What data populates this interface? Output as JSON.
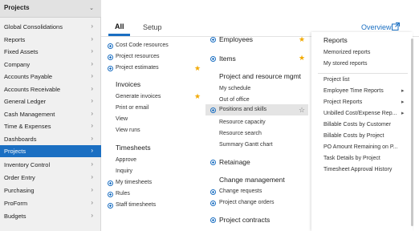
{
  "sidebar": {
    "header": "Projects",
    "items": [
      {
        "label": "Global Consolidations",
        "active": false
      },
      {
        "label": "Reports",
        "active": false
      },
      {
        "label": "Fixed Assets",
        "active": false
      },
      {
        "label": "Company",
        "active": false
      },
      {
        "label": "Accounts Payable",
        "active": false
      },
      {
        "label": "Accounts Receivable",
        "active": false
      },
      {
        "label": "General Ledger",
        "active": false
      },
      {
        "label": "Cash Management",
        "active": false
      },
      {
        "label": "Time & Expenses",
        "active": false
      },
      {
        "label": "Dashboards",
        "active": false
      },
      {
        "label": "Projects",
        "active": true
      },
      {
        "label": "Inventory Control",
        "active": false
      },
      {
        "label": "Order Entry",
        "active": false
      },
      {
        "label": "Purchasing",
        "active": false
      },
      {
        "label": "ProForm",
        "active": false
      },
      {
        "label": "Budgets",
        "active": false
      }
    ]
  },
  "tabs": {
    "all": "All",
    "setup": "Setup",
    "overview": "Overview"
  },
  "col1": {
    "top_items": [
      "Cost Code resources",
      "Project resources",
      "Project estimates"
    ],
    "invoices": {
      "heading": "Invoices",
      "items": [
        "Generate invoices",
        "Print or email",
        "View",
        "View runs"
      ]
    },
    "timesheets": {
      "heading": "Timesheets",
      "items": [
        "Approve",
        "Inquiry",
        "My timesheets",
        "Rules",
        "Staff timesheets"
      ]
    }
  },
  "col2": {
    "employees": "Employees",
    "items": "Items",
    "project_mgmt": {
      "heading": "Project and resource mgmt",
      "items": [
        "My schedule",
        "Out of office",
        "Positions and skills",
        "Resource capacity",
        "Resource search",
        "Summary Gantt chart"
      ]
    },
    "retainage": "Retainage",
    "change_mgmt": {
      "heading": "Change management",
      "items": [
        "Change requests",
        "Project change orders"
      ]
    },
    "contracts": "Project contracts"
  },
  "col3": {
    "heading": "Reports",
    "top_items": [
      "Memorized reports",
      "My stored reports"
    ],
    "items": [
      "Project list",
      "Employee Time Reports",
      "Project Reports",
      "Unbilled Cost/Expense Rep...",
      "Billable Costs by Customer",
      "Billable Costs by Project",
      "PO Amount Remaining on P...",
      "Task Details by Project",
      "Timesheet Approval History"
    ]
  },
  "colors": {
    "accent": "#1b6fc2",
    "star": "#f2a900",
    "active_bg": "#1b6fc2"
  },
  "icons": {
    "sidebar_header": "chevron-down-icon",
    "external_link": "external-link-icon",
    "add": "plus-circle-icon",
    "favorite": "star-icon"
  }
}
